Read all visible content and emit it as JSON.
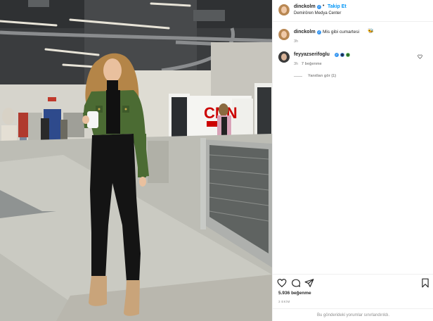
{
  "post": {
    "author": {
      "username": "dinckolm",
      "follow_label": "Takip Et",
      "location": "Demirören Medya Center",
      "verified_mark": "✓"
    },
    "caption": {
      "username": "dinckolm",
      "text": "Mis gibi cumartesi",
      "emoji": "🐝",
      "time": "3h"
    },
    "comments": [
      {
        "username": "feyyazserifoglu",
        "time": "3h",
        "likes": "7 beğenme",
        "view_replies": "Yanıtları gör (1)"
      }
    ],
    "like_count": "5.936 beğenme",
    "date": "3 EKİM",
    "comments_disabled": "Bu gönderideki yorumlar sınırlandırıldı."
  },
  "photo": {
    "sign_text": "CNN",
    "sign_sub": "TÜRK"
  }
}
